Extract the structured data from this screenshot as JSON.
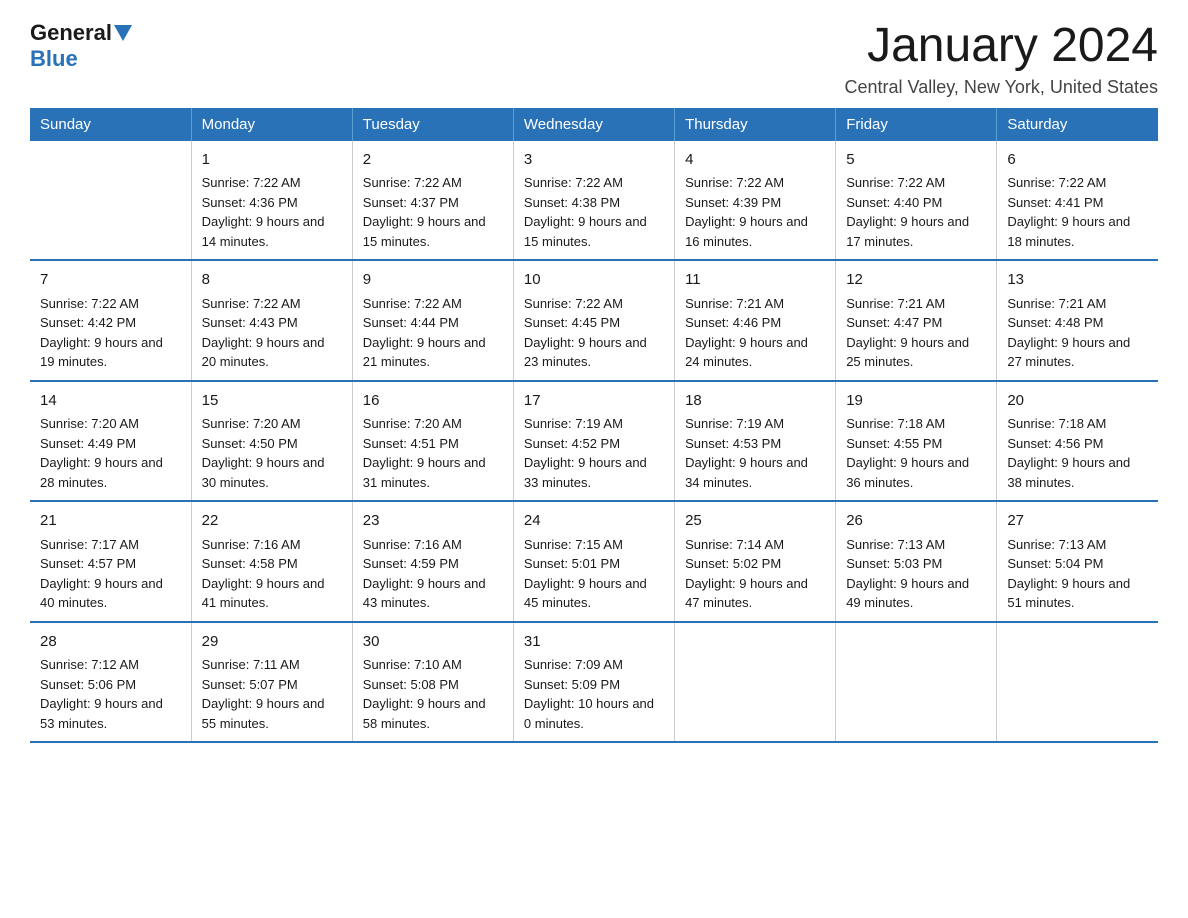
{
  "logo": {
    "general": "General",
    "blue": "Blue"
  },
  "title": "January 2024",
  "location": "Central Valley, New York, United States",
  "days_of_week": [
    "Sunday",
    "Monday",
    "Tuesday",
    "Wednesday",
    "Thursday",
    "Friday",
    "Saturday"
  ],
  "weeks": [
    [
      {
        "day": "",
        "sunrise": "",
        "sunset": "",
        "daylight": ""
      },
      {
        "day": "1",
        "sunrise": "Sunrise: 7:22 AM",
        "sunset": "Sunset: 4:36 PM",
        "daylight": "Daylight: 9 hours and 14 minutes."
      },
      {
        "day": "2",
        "sunrise": "Sunrise: 7:22 AM",
        "sunset": "Sunset: 4:37 PM",
        "daylight": "Daylight: 9 hours and 15 minutes."
      },
      {
        "day": "3",
        "sunrise": "Sunrise: 7:22 AM",
        "sunset": "Sunset: 4:38 PM",
        "daylight": "Daylight: 9 hours and 15 minutes."
      },
      {
        "day": "4",
        "sunrise": "Sunrise: 7:22 AM",
        "sunset": "Sunset: 4:39 PM",
        "daylight": "Daylight: 9 hours and 16 minutes."
      },
      {
        "day": "5",
        "sunrise": "Sunrise: 7:22 AM",
        "sunset": "Sunset: 4:40 PM",
        "daylight": "Daylight: 9 hours and 17 minutes."
      },
      {
        "day": "6",
        "sunrise": "Sunrise: 7:22 AM",
        "sunset": "Sunset: 4:41 PM",
        "daylight": "Daylight: 9 hours and 18 minutes."
      }
    ],
    [
      {
        "day": "7",
        "sunrise": "Sunrise: 7:22 AM",
        "sunset": "Sunset: 4:42 PM",
        "daylight": "Daylight: 9 hours and 19 minutes."
      },
      {
        "day": "8",
        "sunrise": "Sunrise: 7:22 AM",
        "sunset": "Sunset: 4:43 PM",
        "daylight": "Daylight: 9 hours and 20 minutes."
      },
      {
        "day": "9",
        "sunrise": "Sunrise: 7:22 AM",
        "sunset": "Sunset: 4:44 PM",
        "daylight": "Daylight: 9 hours and 21 minutes."
      },
      {
        "day": "10",
        "sunrise": "Sunrise: 7:22 AM",
        "sunset": "Sunset: 4:45 PM",
        "daylight": "Daylight: 9 hours and 23 minutes."
      },
      {
        "day": "11",
        "sunrise": "Sunrise: 7:21 AM",
        "sunset": "Sunset: 4:46 PM",
        "daylight": "Daylight: 9 hours and 24 minutes."
      },
      {
        "day": "12",
        "sunrise": "Sunrise: 7:21 AM",
        "sunset": "Sunset: 4:47 PM",
        "daylight": "Daylight: 9 hours and 25 minutes."
      },
      {
        "day": "13",
        "sunrise": "Sunrise: 7:21 AM",
        "sunset": "Sunset: 4:48 PM",
        "daylight": "Daylight: 9 hours and 27 minutes."
      }
    ],
    [
      {
        "day": "14",
        "sunrise": "Sunrise: 7:20 AM",
        "sunset": "Sunset: 4:49 PM",
        "daylight": "Daylight: 9 hours and 28 minutes."
      },
      {
        "day": "15",
        "sunrise": "Sunrise: 7:20 AM",
        "sunset": "Sunset: 4:50 PM",
        "daylight": "Daylight: 9 hours and 30 minutes."
      },
      {
        "day": "16",
        "sunrise": "Sunrise: 7:20 AM",
        "sunset": "Sunset: 4:51 PM",
        "daylight": "Daylight: 9 hours and 31 minutes."
      },
      {
        "day": "17",
        "sunrise": "Sunrise: 7:19 AM",
        "sunset": "Sunset: 4:52 PM",
        "daylight": "Daylight: 9 hours and 33 minutes."
      },
      {
        "day": "18",
        "sunrise": "Sunrise: 7:19 AM",
        "sunset": "Sunset: 4:53 PM",
        "daylight": "Daylight: 9 hours and 34 minutes."
      },
      {
        "day": "19",
        "sunrise": "Sunrise: 7:18 AM",
        "sunset": "Sunset: 4:55 PM",
        "daylight": "Daylight: 9 hours and 36 minutes."
      },
      {
        "day": "20",
        "sunrise": "Sunrise: 7:18 AM",
        "sunset": "Sunset: 4:56 PM",
        "daylight": "Daylight: 9 hours and 38 minutes."
      }
    ],
    [
      {
        "day": "21",
        "sunrise": "Sunrise: 7:17 AM",
        "sunset": "Sunset: 4:57 PM",
        "daylight": "Daylight: 9 hours and 40 minutes."
      },
      {
        "day": "22",
        "sunrise": "Sunrise: 7:16 AM",
        "sunset": "Sunset: 4:58 PM",
        "daylight": "Daylight: 9 hours and 41 minutes."
      },
      {
        "day": "23",
        "sunrise": "Sunrise: 7:16 AM",
        "sunset": "Sunset: 4:59 PM",
        "daylight": "Daylight: 9 hours and 43 minutes."
      },
      {
        "day": "24",
        "sunrise": "Sunrise: 7:15 AM",
        "sunset": "Sunset: 5:01 PM",
        "daylight": "Daylight: 9 hours and 45 minutes."
      },
      {
        "day": "25",
        "sunrise": "Sunrise: 7:14 AM",
        "sunset": "Sunset: 5:02 PM",
        "daylight": "Daylight: 9 hours and 47 minutes."
      },
      {
        "day": "26",
        "sunrise": "Sunrise: 7:13 AM",
        "sunset": "Sunset: 5:03 PM",
        "daylight": "Daylight: 9 hours and 49 minutes."
      },
      {
        "day": "27",
        "sunrise": "Sunrise: 7:13 AM",
        "sunset": "Sunset: 5:04 PM",
        "daylight": "Daylight: 9 hours and 51 minutes."
      }
    ],
    [
      {
        "day": "28",
        "sunrise": "Sunrise: 7:12 AM",
        "sunset": "Sunset: 5:06 PM",
        "daylight": "Daylight: 9 hours and 53 minutes."
      },
      {
        "day": "29",
        "sunrise": "Sunrise: 7:11 AM",
        "sunset": "Sunset: 5:07 PM",
        "daylight": "Daylight: 9 hours and 55 minutes."
      },
      {
        "day": "30",
        "sunrise": "Sunrise: 7:10 AM",
        "sunset": "Sunset: 5:08 PM",
        "daylight": "Daylight: 9 hours and 58 minutes."
      },
      {
        "day": "31",
        "sunrise": "Sunrise: 7:09 AM",
        "sunset": "Sunset: 5:09 PM",
        "daylight": "Daylight: 10 hours and 0 minutes."
      },
      {
        "day": "",
        "sunrise": "",
        "sunset": "",
        "daylight": ""
      },
      {
        "day": "",
        "sunrise": "",
        "sunset": "",
        "daylight": ""
      },
      {
        "day": "",
        "sunrise": "",
        "sunset": "",
        "daylight": ""
      }
    ]
  ]
}
